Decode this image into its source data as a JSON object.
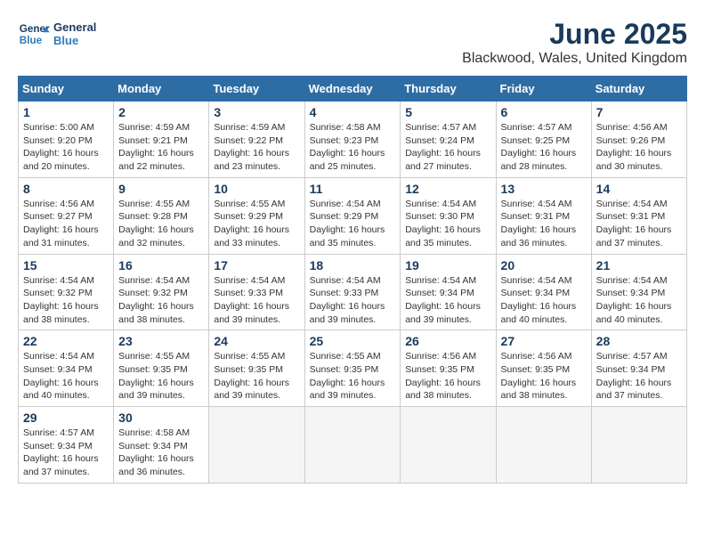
{
  "logo": {
    "text_general": "General",
    "text_blue": "Blue"
  },
  "title": "June 2025",
  "subtitle": "Blackwood, Wales, United Kingdom",
  "columns": [
    "Sunday",
    "Monday",
    "Tuesday",
    "Wednesday",
    "Thursday",
    "Friday",
    "Saturday"
  ],
  "weeks": [
    [
      {
        "day": "1",
        "sunrise": "Sunrise: 5:00 AM",
        "sunset": "Sunset: 9:20 PM",
        "daylight": "Daylight: 16 hours and 20 minutes."
      },
      {
        "day": "2",
        "sunrise": "Sunrise: 4:59 AM",
        "sunset": "Sunset: 9:21 PM",
        "daylight": "Daylight: 16 hours and 22 minutes."
      },
      {
        "day": "3",
        "sunrise": "Sunrise: 4:59 AM",
        "sunset": "Sunset: 9:22 PM",
        "daylight": "Daylight: 16 hours and 23 minutes."
      },
      {
        "day": "4",
        "sunrise": "Sunrise: 4:58 AM",
        "sunset": "Sunset: 9:23 PM",
        "daylight": "Daylight: 16 hours and 25 minutes."
      },
      {
        "day": "5",
        "sunrise": "Sunrise: 4:57 AM",
        "sunset": "Sunset: 9:24 PM",
        "daylight": "Daylight: 16 hours and 27 minutes."
      },
      {
        "day": "6",
        "sunrise": "Sunrise: 4:57 AM",
        "sunset": "Sunset: 9:25 PM",
        "daylight": "Daylight: 16 hours and 28 minutes."
      },
      {
        "day": "7",
        "sunrise": "Sunrise: 4:56 AM",
        "sunset": "Sunset: 9:26 PM",
        "daylight": "Daylight: 16 hours and 30 minutes."
      }
    ],
    [
      {
        "day": "8",
        "sunrise": "Sunrise: 4:56 AM",
        "sunset": "Sunset: 9:27 PM",
        "daylight": "Daylight: 16 hours and 31 minutes."
      },
      {
        "day": "9",
        "sunrise": "Sunrise: 4:55 AM",
        "sunset": "Sunset: 9:28 PM",
        "daylight": "Daylight: 16 hours and 32 minutes."
      },
      {
        "day": "10",
        "sunrise": "Sunrise: 4:55 AM",
        "sunset": "Sunset: 9:29 PM",
        "daylight": "Daylight: 16 hours and 33 minutes."
      },
      {
        "day": "11",
        "sunrise": "Sunrise: 4:54 AM",
        "sunset": "Sunset: 9:29 PM",
        "daylight": "Daylight: 16 hours and 35 minutes."
      },
      {
        "day": "12",
        "sunrise": "Sunrise: 4:54 AM",
        "sunset": "Sunset: 9:30 PM",
        "daylight": "Daylight: 16 hours and 35 minutes."
      },
      {
        "day": "13",
        "sunrise": "Sunrise: 4:54 AM",
        "sunset": "Sunset: 9:31 PM",
        "daylight": "Daylight: 16 hours and 36 minutes."
      },
      {
        "day": "14",
        "sunrise": "Sunrise: 4:54 AM",
        "sunset": "Sunset: 9:31 PM",
        "daylight": "Daylight: 16 hours and 37 minutes."
      }
    ],
    [
      {
        "day": "15",
        "sunrise": "Sunrise: 4:54 AM",
        "sunset": "Sunset: 9:32 PM",
        "daylight": "Daylight: 16 hours and 38 minutes."
      },
      {
        "day": "16",
        "sunrise": "Sunrise: 4:54 AM",
        "sunset": "Sunset: 9:32 PM",
        "daylight": "Daylight: 16 hours and 38 minutes."
      },
      {
        "day": "17",
        "sunrise": "Sunrise: 4:54 AM",
        "sunset": "Sunset: 9:33 PM",
        "daylight": "Daylight: 16 hours and 39 minutes."
      },
      {
        "day": "18",
        "sunrise": "Sunrise: 4:54 AM",
        "sunset": "Sunset: 9:33 PM",
        "daylight": "Daylight: 16 hours and 39 minutes."
      },
      {
        "day": "19",
        "sunrise": "Sunrise: 4:54 AM",
        "sunset": "Sunset: 9:34 PM",
        "daylight": "Daylight: 16 hours and 39 minutes."
      },
      {
        "day": "20",
        "sunrise": "Sunrise: 4:54 AM",
        "sunset": "Sunset: 9:34 PM",
        "daylight": "Daylight: 16 hours and 40 minutes."
      },
      {
        "day": "21",
        "sunrise": "Sunrise: 4:54 AM",
        "sunset": "Sunset: 9:34 PM",
        "daylight": "Daylight: 16 hours and 40 minutes."
      }
    ],
    [
      {
        "day": "22",
        "sunrise": "Sunrise: 4:54 AM",
        "sunset": "Sunset: 9:34 PM",
        "daylight": "Daylight: 16 hours and 40 minutes."
      },
      {
        "day": "23",
        "sunrise": "Sunrise: 4:55 AM",
        "sunset": "Sunset: 9:35 PM",
        "daylight": "Daylight: 16 hours and 39 minutes."
      },
      {
        "day": "24",
        "sunrise": "Sunrise: 4:55 AM",
        "sunset": "Sunset: 9:35 PM",
        "daylight": "Daylight: 16 hours and 39 minutes."
      },
      {
        "day": "25",
        "sunrise": "Sunrise: 4:55 AM",
        "sunset": "Sunset: 9:35 PM",
        "daylight": "Daylight: 16 hours and 39 minutes."
      },
      {
        "day": "26",
        "sunrise": "Sunrise: 4:56 AM",
        "sunset": "Sunset: 9:35 PM",
        "daylight": "Daylight: 16 hours and 38 minutes."
      },
      {
        "day": "27",
        "sunrise": "Sunrise: 4:56 AM",
        "sunset": "Sunset: 9:35 PM",
        "daylight": "Daylight: 16 hours and 38 minutes."
      },
      {
        "day": "28",
        "sunrise": "Sunrise: 4:57 AM",
        "sunset": "Sunset: 9:34 PM",
        "daylight": "Daylight: 16 hours and 37 minutes."
      }
    ],
    [
      {
        "day": "29",
        "sunrise": "Sunrise: 4:57 AM",
        "sunset": "Sunset: 9:34 PM",
        "daylight": "Daylight: 16 hours and 37 minutes."
      },
      {
        "day": "30",
        "sunrise": "Sunrise: 4:58 AM",
        "sunset": "Sunset: 9:34 PM",
        "daylight": "Daylight: 16 hours and 36 minutes."
      },
      null,
      null,
      null,
      null,
      null
    ]
  ]
}
